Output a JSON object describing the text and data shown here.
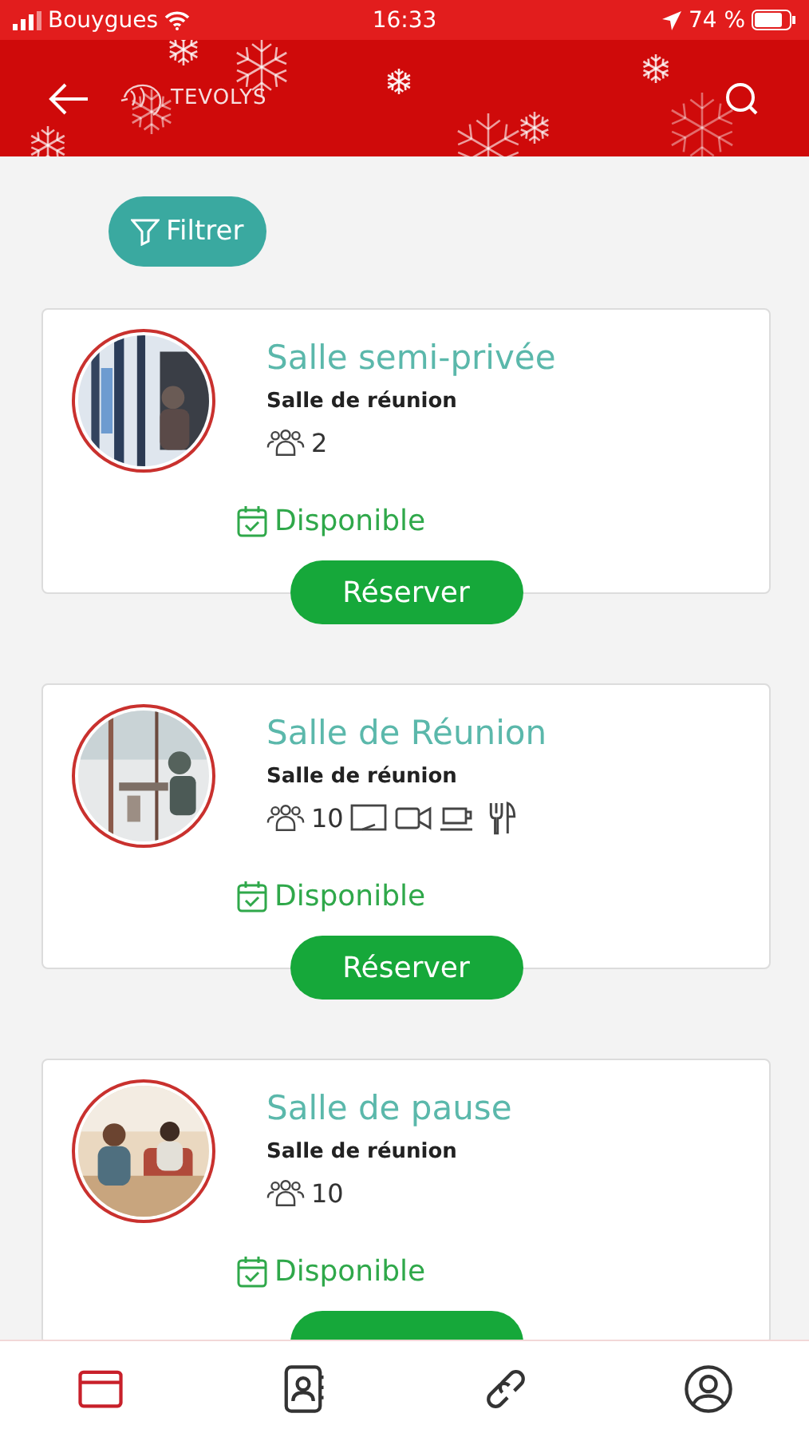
{
  "status_bar": {
    "carrier": "Bouygues",
    "time": "16:33",
    "battery": "74 %"
  },
  "header": {
    "logo": "TEVOLYS"
  },
  "filter_button": {
    "label": "Filtrer"
  },
  "rooms": [
    {
      "title": "Salle semi-privée",
      "type": "Salle de réunion",
      "capacity": "2",
      "availability": "Disponible",
      "button": "Réserver"
    },
    {
      "title": "Salle de Réunion",
      "type": "Salle de réunion",
      "capacity": "10",
      "amenities": [
        {
          "kind": "screen"
        },
        {
          "kind": "video"
        },
        {
          "kind": "coffee"
        },
        {
          "kind": "cutlery"
        }
      ],
      "availability": "Disponible",
      "button": "Réserver"
    },
    {
      "title": "Salle de pause",
      "type": "Salle de réunion",
      "capacity": "10",
      "availability": "Disponible"
    }
  ],
  "bottom_nav": [
    {
      "kind": "rooms",
      "selected": true
    },
    {
      "kind": "contacts",
      "selected": false
    },
    {
      "kind": "links",
      "selected": false
    },
    {
      "kind": "profile",
      "selected": false
    }
  ]
}
